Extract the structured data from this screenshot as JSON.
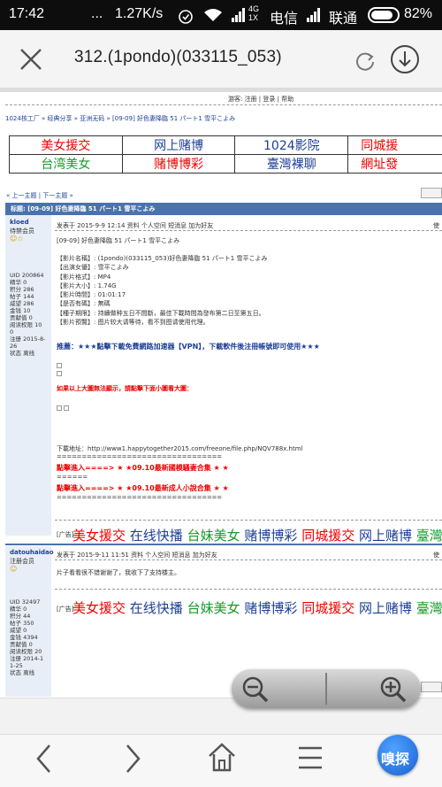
{
  "status_bar": {
    "time": "17:42",
    "dots": "...",
    "speed": "1.27K/s",
    "net_type": "4G",
    "net_sub": "1X",
    "carrier1": "电信",
    "carrier2": "联通",
    "battery": "82%"
  },
  "browser": {
    "url": "312.(1pondo)(033115_053)",
    "search_icon": "search-icon"
  },
  "page": {
    "top_links": "游客: 注册 | 登录 | 帮助",
    "breadcrumb": "1024核工厂 » 经典分享 » 亚洲无码 » [09-09] 好色妻降臨 51 パート1 雪平こよみ",
    "ads": [
      [
        "美女援交",
        "网上赌博",
        "1024影院",
        "同城援"
      ],
      [
        "台湾美女",
        "赌博博彩",
        "臺灣裸聊",
        "網址發"
      ]
    ],
    "topic_nav": "« 上一主题 | 下一主题 »",
    "thread_title": "标题: [09-09] 好色妻降臨 51 パート1 雪平こよみ",
    "post1": {
      "user": "kloed",
      "rank": "待禁会员",
      "meta": "发表于 2015-9-9 12:14  资料  个人空间  短消息  加为好友",
      "corner": "使",
      "stats": [
        "UID 200864",
        "精华 0",
        "积分 286",
        "帖子 144",
        "威望 286",
        "金钱 10",
        "贡献值 0",
        "阅读权限 10",
        "0",
        "注册 2015-8-",
        "26",
        "状态 离线"
      ],
      "title": "[09-09] 好色妻降臨 51 パート1 雪平こよみ",
      "info": [
        "【影片名稱】: (1pondo)(033115_053)好色妻降臨 51 パート1 雪平こよみ",
        "【出演女優】: 雪平こよみ",
        "【影片格式】: MP4",
        "【影片大小】: 1.74G",
        "【影片時間】: 01:01:17",
        "【是否有碼】: 無碼",
        "【種子期限】: 持續做种五日不間斷，最佳下載時間為發布第二日至第五日。",
        "【影片預覽】: 图片较大请等待，看不到图请使用代理。"
      ],
      "recommend": "推薦：★★★點擊下載免費網路加速器【VPN】，下載軟件後注冊帳號即可使用★★★",
      "big_img_tip": "如果以上大圖無法顯示，請點擊下面小圖看大圖：",
      "download": "下載地址：http://www1.happytogether2015.com/freeone/file.php/NQV788x.html",
      "sep1": "=================================",
      "promo1": "點擊進入====> ★ ★09.10最新國模騷妻合集 ★ ★",
      "sep2": "======",
      "promo2": "點擊進入====> ★ ★09.10最新成人小說合集 ★ ★",
      "sep3": "=================================",
      "ad_label": "[广告]",
      "ad_links": [
        "美女援交",
        "在线快播",
        "台妹美女",
        "赌博博彩",
        "同城援交",
        "网上赌博",
        "臺灣"
      ]
    },
    "post2": {
      "user": "datouhaidao",
      "rank": "注册会员",
      "meta": "发表于 2015-9-11 11:51  资料  个人空间  短消息  加为好友",
      "corner": "使",
      "stats": [
        "UID 32497",
        "精华 0",
        "积分 44",
        "帖子 350",
        "威望 0",
        "金钱 4394",
        "贡献值 0",
        "阅读权限 20",
        "注册 2014-1",
        "1-25",
        "状态 离线"
      ],
      "body": "片子看看很不错谢谢了，我收下了支持楼主。",
      "ad_label": "[广告]",
      "ad_links": [
        "美女援交",
        "在线快播",
        "台妹美女",
        "赌博博彩",
        "同城援交",
        "网上赌博",
        "臺灣"
      ]
    },
    "zoom_out_icon": "zoom-out-icon",
    "zoom_in_icon": "zoom-in-icon"
  },
  "bottom_nav": {
    "assistant_label": "嗅探"
  }
}
